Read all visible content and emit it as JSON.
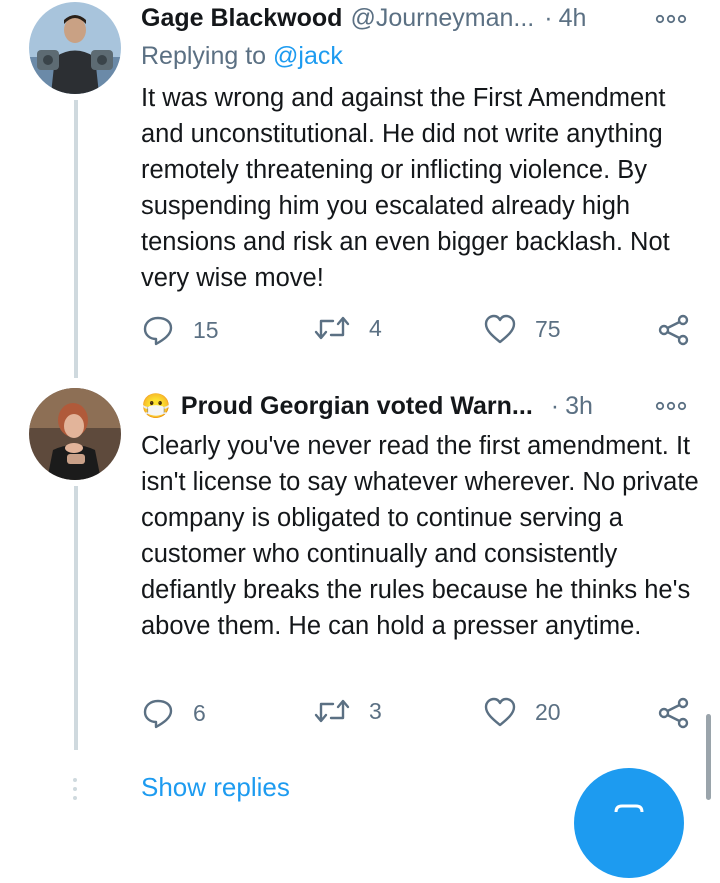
{
  "tweets": [
    {
      "author_name": "Gage Blackwood",
      "handle": "@Journeyman...",
      "separator": "·",
      "time": "4h",
      "replying_prefix": "Replying to",
      "replying_handle": "@jack",
      "text": "It was wrong and against the First Amendment and unconstitutional. He did not write anything remotely threatening or inflicting violence. By suspending him you escalated already high tensions and risk an even bigger backlash. Not very wise move!",
      "replies": "15",
      "retweets": "4",
      "likes": "75"
    },
    {
      "author_emoji": "😷",
      "author_name": "Proud Georgian voted Warn...",
      "separator": "·",
      "time": "3h",
      "text": "Clearly you've never read the first amendment. It isn't license to say whatever wherever.  No private company is obligated to continue serving a customer who continually and consistently defiantly breaks the rules because he thinks he's above them. He can hold a presser anytime.",
      "replies": "6",
      "retweets": "3",
      "likes": "20"
    }
  ],
  "show_replies_label": "Show replies",
  "icons": {
    "more": "more-horizontal-icon",
    "reply": "reply-icon",
    "retweet": "retweet-icon",
    "like": "heart-icon",
    "share": "share-icon",
    "compose": "compose-icon"
  },
  "colors": {
    "accent": "#1d9bf0",
    "secondary_text": "#5b7083",
    "thread_line": "#cfd9de"
  }
}
